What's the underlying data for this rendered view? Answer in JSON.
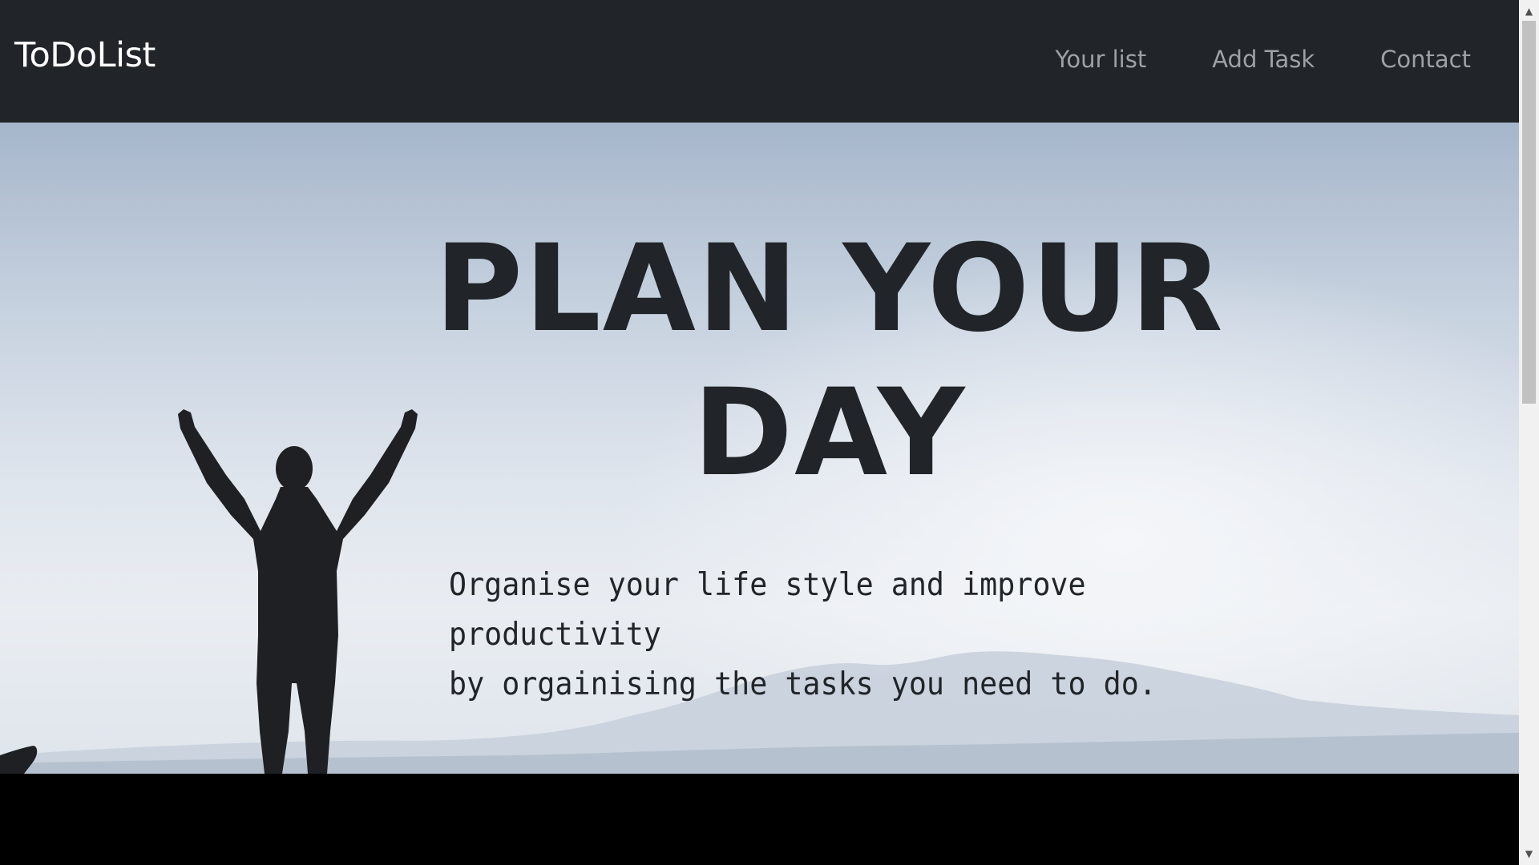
{
  "navbar": {
    "brand": "ToDoList",
    "links": [
      {
        "label": "Your list"
      },
      {
        "label": "Add Task"
      },
      {
        "label": "Contact"
      }
    ]
  },
  "hero": {
    "title_line1": "PLAN YOUR",
    "title_line2": "DAY",
    "text_line1": "Organise your life style and improve productivity",
    "text_line2": "by orgainising the tasks you need to do."
  },
  "colors": {
    "navbar_bg": "#212529",
    "brand_text": "#ffffff",
    "nav_link": "#9ea2a6",
    "hero_text": "#212529",
    "page_bg": "#000000"
  },
  "icons": {
    "scroll_up": "scroll-up-arrow-icon",
    "scroll_down": "scroll-down-arrow-icon"
  }
}
